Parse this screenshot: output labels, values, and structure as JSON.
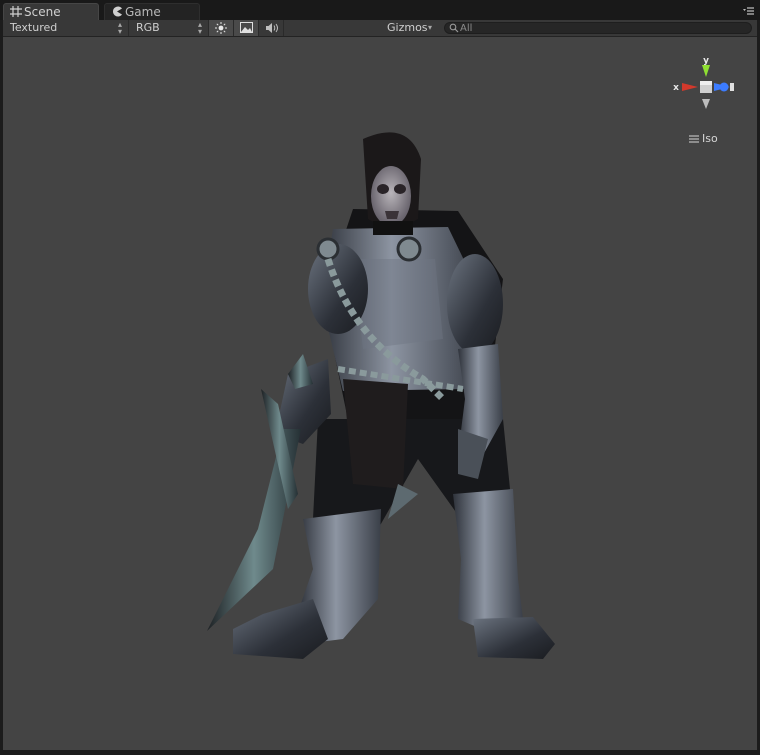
{
  "tabs": [
    {
      "label": "Scene",
      "icon": "grid-icon",
      "active": true
    },
    {
      "label": "Game",
      "icon": "pacman-icon",
      "active": false
    }
  ],
  "toolbar": {
    "draw_mode": "Textured",
    "render_mode": "RGB",
    "lighting_icon": "sun-icon",
    "image_icon": "image-icon",
    "audio_icon": "speaker-icon",
    "gizmos_label": "Gizmos",
    "search_placeholder": "All"
  },
  "viewport": {
    "background_color": "#444444",
    "projection_label": "Iso",
    "gizmo_axes": {
      "y": "y",
      "x": "x",
      "y_color": "#8fdf32",
      "x_color": "#d2392c",
      "z_color": "#3c7cff"
    }
  }
}
